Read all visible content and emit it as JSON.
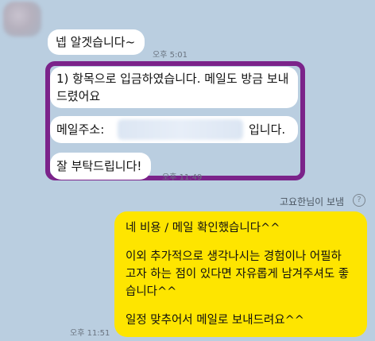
{
  "chat": {
    "incoming_first": {
      "text": "넵 알겟습니다~",
      "time": "오후 5:01"
    },
    "incoming_group": {
      "line1a": "1) 항목으로 입금하였습니다. 메일도 방금 보내",
      "line1b": "드렸어요",
      "email_label": "메일주소:",
      "email_suffix": "입니다.",
      "closing": "잘 부탁드립니다!",
      "time": "오후 11:49"
    },
    "outgoing": {
      "sender_label": "고요한님이 보냄",
      "help_glyph": "?",
      "line1": "네 비용 / 메일 확인했습니다^^",
      "line2": "이외 추가적으로 생각나시는 경험이나 어필하",
      "line3": "고자 하는 점이 있다면 자유롭게 남겨주셔도 좋",
      "line4": "습니다^^",
      "line5": "일정 맞추어서 메일로 보내드려요^^",
      "time": "오후 11:51"
    }
  },
  "colors": {
    "background": "#bacee0",
    "incoming_bubble": "#ffffff",
    "outgoing_bubble": "#fee500",
    "highlight_border": "#7b238a"
  }
}
